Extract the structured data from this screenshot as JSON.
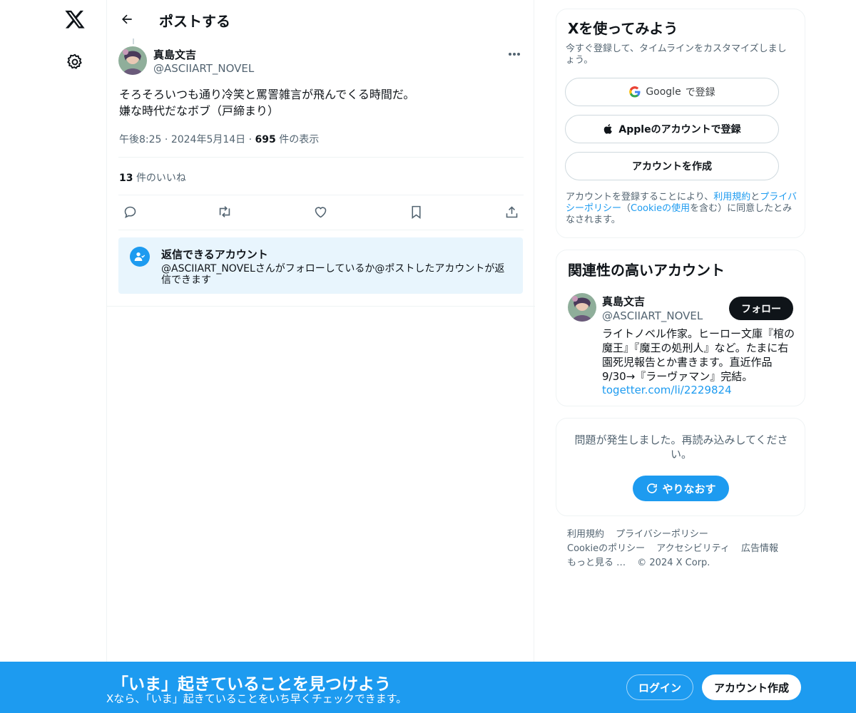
{
  "nav": {
    "logo_icon": "x-logo-icon",
    "settings_icon": "gear-icon"
  },
  "header": {
    "title": "ポストする",
    "back_icon": "arrow-left-icon"
  },
  "post": {
    "author_name": "真島文吉",
    "author_handle": "@ASCIIART_NOVEL",
    "text_line1": "そろそろいつも通り冷笑と罵詈雑言が飛んでくる時間だ。",
    "text_line2": "嫌な時代だなボブ（戸締まり）",
    "time": "午後8:25",
    "sep1": "·",
    "date": "2024年5月14日",
    "sep2": "·",
    "views_count": "695",
    "views_label": "件の表示",
    "likes_count": "13",
    "likes_label": "件のいいね",
    "actions": [
      "reply-icon",
      "retweet-icon",
      "like-icon",
      "bookmark-icon",
      "share-icon"
    ]
  },
  "reply_restriction": {
    "title": "返信できるアカウント",
    "description": "@ASCIIART_NOVELさんがフォローしているか@ポストしたアカウントが返信できます"
  },
  "signup_card": {
    "title": "Xを使ってみよう",
    "subtitle": "今すぐ登録して、タイムラインをカスタマイズしましょう。",
    "google_brand": "Google",
    "google_label": "で登録",
    "apple_label": "Appleのアカウントで登録",
    "create_label": "アカウントを作成",
    "terms_prefix": "アカウントを登録することにより、",
    "terms_link1": "利用規約",
    "terms_and": "と",
    "terms_link2": "プライバシーポリシー",
    "terms_mid": "（",
    "terms_link3": "Cookieの使用",
    "terms_suffix": "を含む）に同意したとみなされます。"
  },
  "recommend_card": {
    "title": "関連性の高いアカウント",
    "name": "真島文吉",
    "handle": "@ASCIIART_NOVEL",
    "follow_label": "フォロー",
    "bio": "ライトノベル作家。ヒーロー文庫『棺の魔王』『魔王の処刑人』など。たまに右園死児報告とか書きます。直近作品9/30→『ラーヴァマン』完結。",
    "link": "togetter.com/li/2229824"
  },
  "error_card": {
    "message": "問題が発生しました。再読み込みしてください。",
    "retry_label": "やりなおす"
  },
  "footer": {
    "row1": [
      "利用規約",
      "プライバシーポリシー"
    ],
    "row2": [
      "Cookieのポリシー",
      "アクセシビリティ",
      "広告情報"
    ],
    "row3": [
      "もっと見る …",
      "© 2024 X Corp."
    ]
  },
  "banner": {
    "title": "「いま」起きていることを見つけよう",
    "subtitle": "Xなら、「いま」起きていることをいち早くチェックできます。",
    "login_label": "ログイン",
    "signup_label": "アカウント作成"
  },
  "colors": {
    "accent": "#1d9bf0",
    "text": "#0f1419",
    "muted": "#536471"
  }
}
